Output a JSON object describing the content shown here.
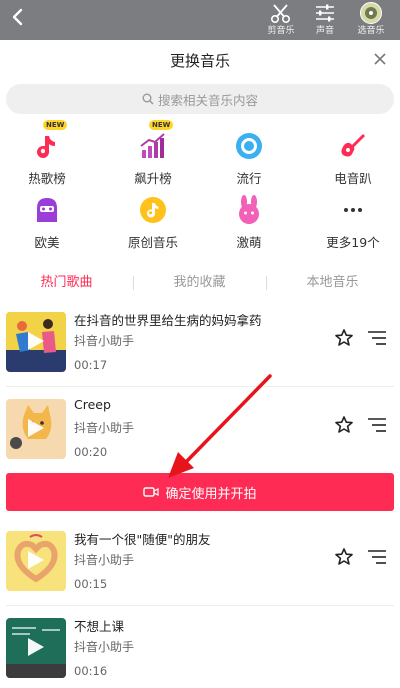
{
  "toolbar": {
    "tools": [
      {
        "label": "剪音乐",
        "icon": "scissors-icon"
      },
      {
        "label": "声音",
        "icon": "sliders-icon"
      },
      {
        "label": "选音乐",
        "icon": "music-disc-icon"
      }
    ]
  },
  "sheet": {
    "title": "更换音乐",
    "search_placeholder": "搜索相关音乐内容"
  },
  "categories": [
    {
      "label": "热歌榜",
      "icon": "tiktok-note-icon",
      "badge": "NEW",
      "color": "#fe2c55"
    },
    {
      "label": "飙升榜",
      "icon": "rising-bars-icon",
      "badge": "NEW",
      "color": "#b43aa8"
    },
    {
      "label": "流行",
      "icon": "target-icon",
      "color": "#3ab0f2"
    },
    {
      "label": "电音趴",
      "icon": "guitar-icon",
      "color": "#fe2c55"
    },
    {
      "label": "欧美",
      "icon": "person-icon",
      "color": "#9b3dd8"
    },
    {
      "label": "原创音乐",
      "icon": "tiktok-circle-icon",
      "color": "#ffc21a"
    },
    {
      "label": "激萌",
      "icon": "bunny-icon",
      "color": "#f260b8"
    },
    {
      "label": "更多19个",
      "icon": "more-icon",
      "color": "#333333"
    }
  ],
  "tabs": [
    {
      "label": "热门歌曲",
      "active": true
    },
    {
      "label": "我的收藏",
      "active": false
    },
    {
      "label": "本地音乐",
      "active": false
    }
  ],
  "songs": [
    {
      "title": "在抖音的世界里给生病的妈妈拿药",
      "artist": "抖音小助手",
      "duration": "00:17"
    },
    {
      "title": "Creep",
      "artist": "抖音小助手",
      "duration": "00:20"
    },
    {
      "title": "我有一个很\"随便\"的朋友",
      "artist": "抖音小助手",
      "duration": "00:15"
    },
    {
      "title": "不想上课",
      "artist": "抖音小助手",
      "duration": "00:16"
    }
  ],
  "confirm_button": {
    "label": "确定使用并开拍"
  },
  "colors": {
    "accent": "#fe2c55"
  }
}
